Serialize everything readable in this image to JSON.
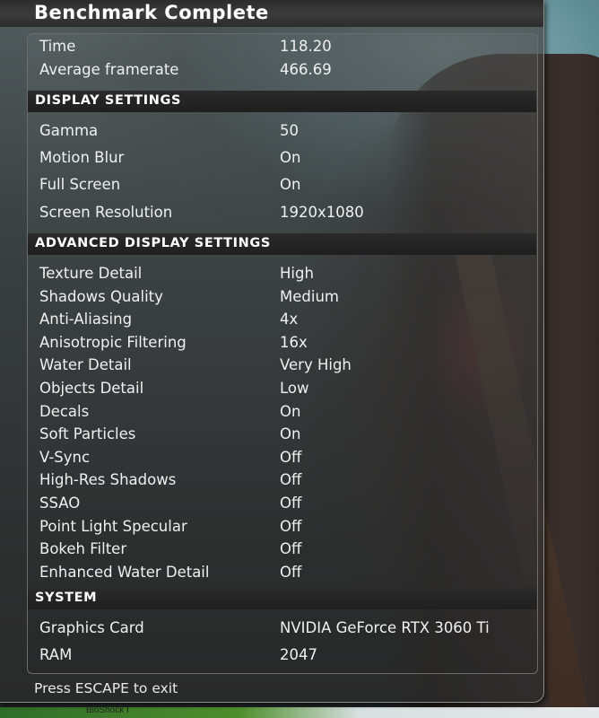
{
  "window": {
    "title": "Benchmark Complete"
  },
  "results": [
    {
      "label": "Time",
      "value": "118.20"
    },
    {
      "label": "Average framerate",
      "value": "466.69"
    }
  ],
  "display": {
    "header": "DISPLAY SETTINGS",
    "items": [
      {
        "label": "Gamma",
        "value": "50"
      },
      {
        "label": "Motion Blur",
        "value": "On"
      },
      {
        "label": "Full Screen",
        "value": "On"
      },
      {
        "label": "Screen Resolution",
        "value": "1920x1080"
      }
    ]
  },
  "advanced": {
    "header": "ADVANCED DISPLAY SETTINGS",
    "items": [
      {
        "label": "Texture Detail",
        "value": "High"
      },
      {
        "label": "Shadows Quality",
        "value": "Medium"
      },
      {
        "label": "Anti-Aliasing",
        "value": "4x"
      },
      {
        "label": "Anisotropic Filtering",
        "value": "16x"
      },
      {
        "label": "Water Detail",
        "value": "Very High"
      },
      {
        "label": "Objects Detail",
        "value": "Low"
      },
      {
        "label": "Decals",
        "value": "On"
      },
      {
        "label": "Soft Particles",
        "value": "On"
      },
      {
        "label": "V-Sync",
        "value": "Off"
      },
      {
        "label": "High-Res Shadows",
        "value": "Off"
      },
      {
        "label": "SSAO",
        "value": "Off"
      },
      {
        "label": "Point Light Specular",
        "value": "Off"
      },
      {
        "label": "Bokeh Filter",
        "value": "Off"
      },
      {
        "label": "Enhanced Water Detail",
        "value": "Off"
      }
    ]
  },
  "system": {
    "header": "SYSTEM",
    "items": [
      {
        "label": "Graphics Card",
        "value": "NVIDIA GeForce RTX 3060 Ti"
      },
      {
        "label": "RAM",
        "value": "2047"
      }
    ]
  },
  "footer": {
    "hint": "Press ESCAPE to exit"
  },
  "taskbar": {
    "item": "BioShock I"
  }
}
